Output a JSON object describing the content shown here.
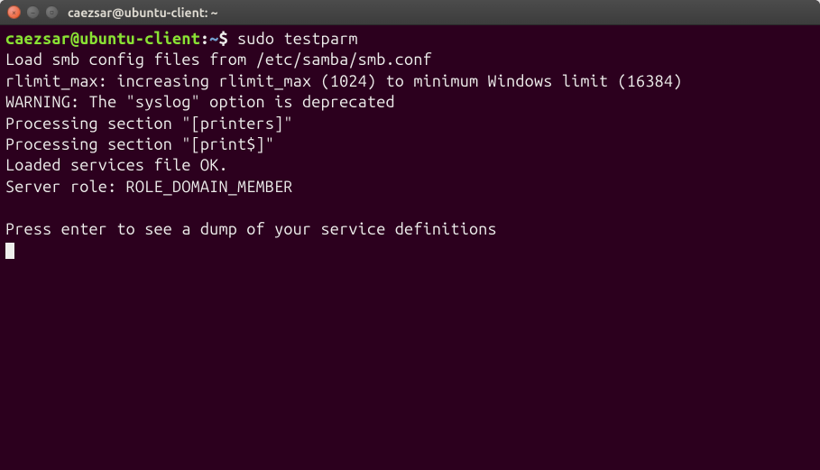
{
  "titlebar": {
    "title": "caezsar@ubuntu-client: ~"
  },
  "prompt": {
    "user_host": "caezsar@ubuntu-client",
    "separator": ":",
    "path": "~",
    "symbol": "$ "
  },
  "command": "sudo testparm",
  "output_lines": [
    "Load smb config files from /etc/samba/smb.conf",
    "rlimit_max: increasing rlimit_max (1024) to minimum Windows limit (16384)",
    "WARNING: The \"syslog\" option is deprecated",
    "Processing section \"[printers]\"",
    "Processing section \"[print$]\"",
    "Loaded services file OK.",
    "Server role: ROLE_DOMAIN_MEMBER",
    "",
    "Press enter to see a dump of your service definitions"
  ]
}
